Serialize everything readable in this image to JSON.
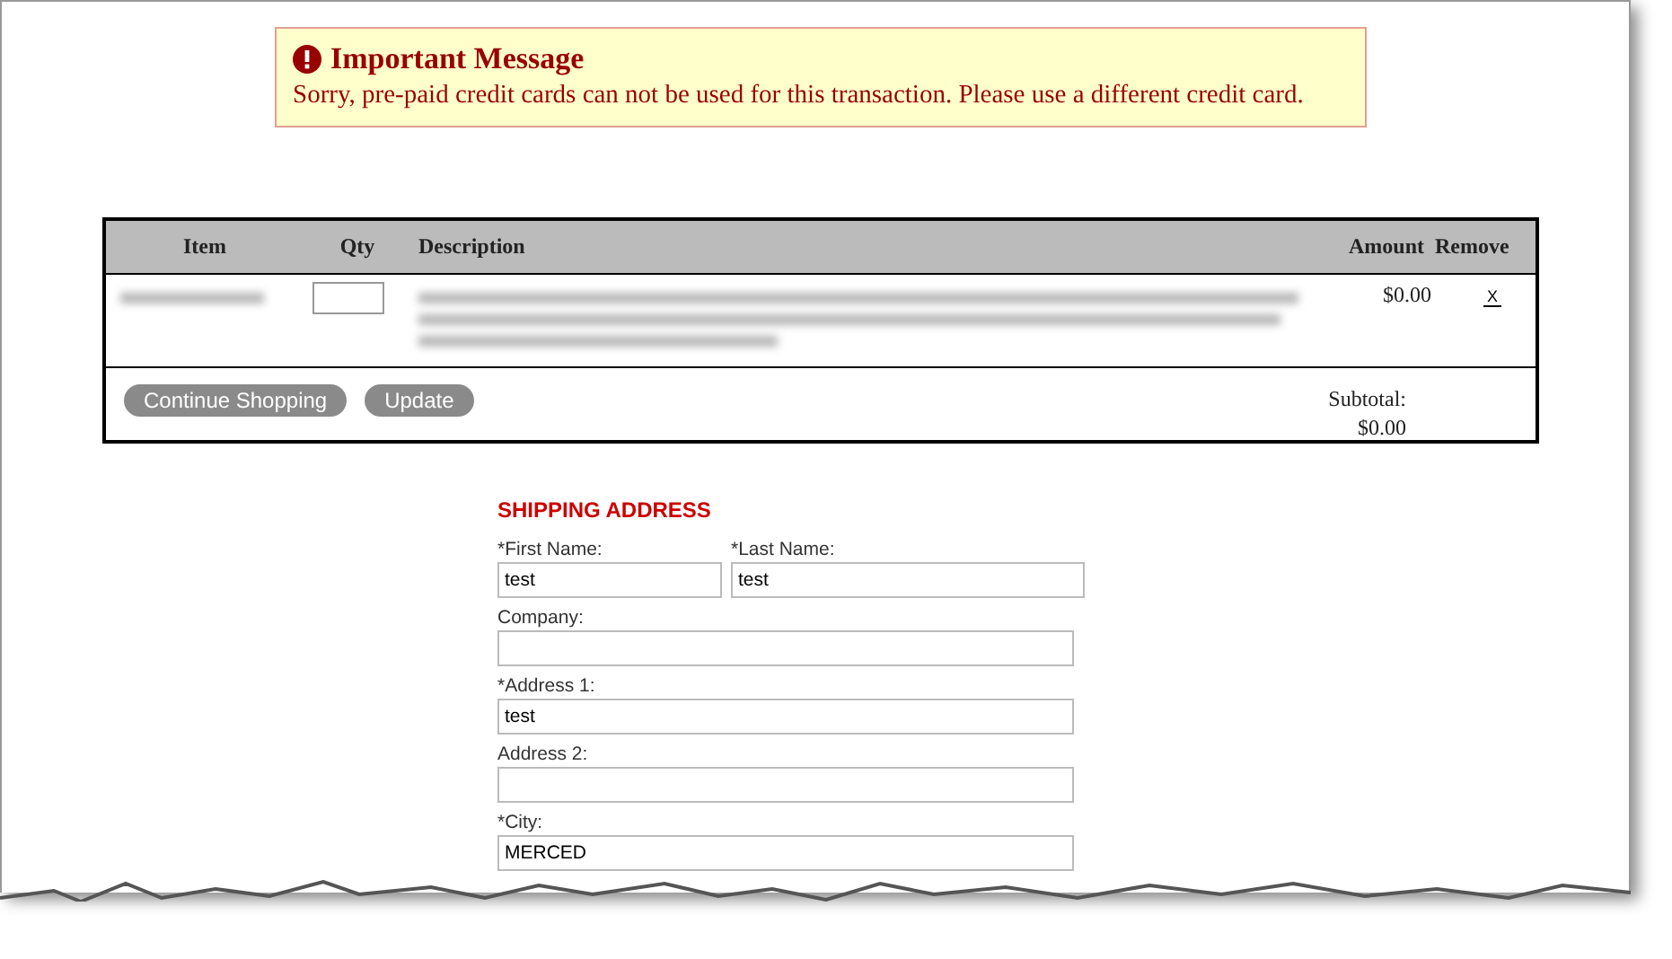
{
  "message": {
    "title": "Important Message",
    "text": "Sorry, pre-paid credit cards can not be used for this transaction. Please use a different credit card."
  },
  "cart": {
    "columns": [
      "Item",
      "Qty",
      "Description",
      "Amount",
      "Remove"
    ],
    "rows": [
      {
        "amount": "$0.00",
        "remove": "X"
      }
    ],
    "buttons": [
      "Continue Shopping",
      "Update"
    ],
    "subtotal_label": "Subtotal:",
    "subtotal": "$0.00"
  },
  "shipping": {
    "title": "SHIPPING ADDRESS",
    "field_rows": [
      [
        {
          "label": "*First Name:",
          "value": "test"
        },
        {
          "label": "*Last Name:",
          "value": "test"
        }
      ],
      [
        {
          "label": "Company:"
        }
      ],
      [
        {
          "label": "*Address 1:",
          "value": "test"
        }
      ],
      [
        {
          "label": "Address 2:"
        }
      ],
      [
        {
          "label": "*City:",
          "value": "MERCED"
        }
      ]
    ]
  }
}
